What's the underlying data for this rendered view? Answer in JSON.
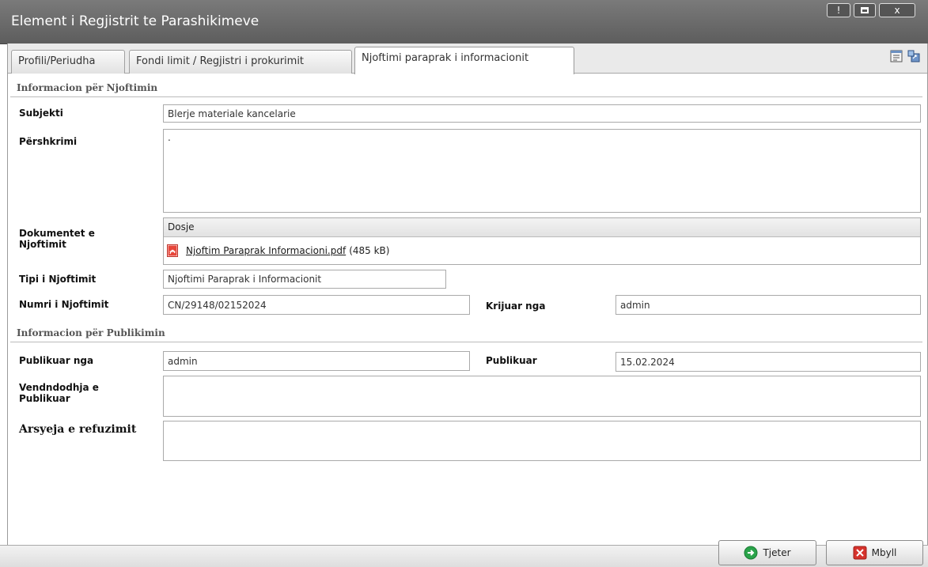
{
  "window": {
    "title": "Element i Regjistrit te Parashikimeve",
    "controls": [
      "!",
      "",
      "x"
    ]
  },
  "tabs": [
    {
      "label": "Profili/Periudha",
      "active": false
    },
    {
      "label": "Fondi limit / Regjistri i prokurimit",
      "active": false
    },
    {
      "label": "Njoftimi paraprak i informacionit",
      "active": true
    }
  ],
  "toolbar_icons": [
    "report-icon",
    "export-icon"
  ],
  "sections": {
    "notice_info": "Informacion për Njoftimin",
    "publication_info": "Informacion për Publikimin"
  },
  "fields": {
    "subjekti": {
      "label": "Subjekti",
      "value": "Blerje materiale kancelarie"
    },
    "pershkrimi": {
      "label": "Përshkrimi",
      "value": "."
    },
    "dokumentet": {
      "label": "Dokumentet e Njoftimit",
      "column": "Dosje",
      "files": [
        {
          "name": "Njoftim Paraprak Informacioni.pdf",
          "size": "(485 kB)"
        }
      ]
    },
    "tipi": {
      "label": "Tipi i Njoftimit",
      "value": "Njoftimi Paraprak i Informacionit"
    },
    "numri": {
      "label": "Numri i Njoftimit",
      "value": "CN/29148/02152024"
    },
    "krijuar": {
      "label": "Krijuar nga",
      "value": "admin"
    },
    "publikuar_nga": {
      "label": "Publikuar nga",
      "value": "admin"
    },
    "publikuar": {
      "label": "Publikuar",
      "value": "15.02.2024"
    },
    "vendndodhja": {
      "label": "Vendndodhja e Publikuar",
      "value": ""
    },
    "arsyeja": {
      "label": "Arsyeja e refuzimit",
      "value": ""
    }
  },
  "buttons": {
    "next": "Tjeter",
    "close": "Mbyll"
  },
  "colors": {
    "titlebar": "#6a6a6a",
    "next_icon": "#2aa34a",
    "close_icon": "#d6322c"
  }
}
